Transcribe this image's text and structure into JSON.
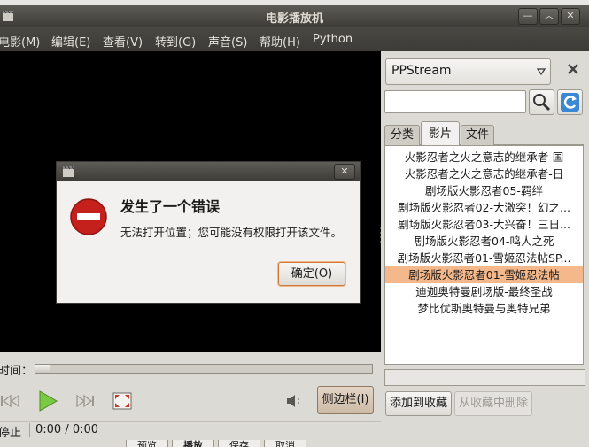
{
  "window": {
    "title": "电影播放机"
  },
  "menu": [
    {
      "label": "电影(M)"
    },
    {
      "label": "编辑(E)"
    },
    {
      "label": "查看(V)"
    },
    {
      "label": "转到(G)"
    },
    {
      "label": "声音(S)"
    },
    {
      "label": "帮助(H)"
    },
    {
      "label": "Python"
    }
  ],
  "dialog": {
    "heading": "发生了一个错误",
    "message": "无法打开位置；您可能没有权限打开该文件。",
    "ok_label": "确定(O)"
  },
  "controls": {
    "time_label": "时间：",
    "sidebar_toggle_label": "侧边栏(I)",
    "status_text": "停止",
    "time_text": "0:00 / 0:00",
    "progress": 0
  },
  "sidebar": {
    "source_selected": "PPStream",
    "search_value": "",
    "tabs": [
      {
        "label": "分类"
      },
      {
        "label": "影片"
      },
      {
        "label": "文件"
      }
    ],
    "items": [
      {
        "label": "火影忍者之火之意志的继承者-国"
      },
      {
        "label": "火影忍者之火之意志的继承者-日"
      },
      {
        "label": "剧场版火影忍者05-羁绊"
      },
      {
        "label": "剧场版火影忍者02-大激突！幻之..."
      },
      {
        "label": "剧场版火影忍者03-大兴奋！三日..."
      },
      {
        "label": "剧场版火影忍者04-鸣人之死"
      },
      {
        "label": "剧场版火影忍者01-雪姬忍法帖SP..."
      },
      {
        "label": "剧场版火影忍者01-雪姬忍法帖"
      },
      {
        "label": "迪迦奥特曼剧场版-最终圣战"
      },
      {
        "label": "梦比优斯奥特曼与奥特兄弟"
      }
    ],
    "add_fav_label": "添加到收藏",
    "remove_fav_label": "从收藏中删除"
  },
  "background_bottom": [
    {
      "label": "预览"
    },
    {
      "label": "播放"
    },
    {
      "label": "保存"
    },
    {
      "label": "取消"
    }
  ]
}
